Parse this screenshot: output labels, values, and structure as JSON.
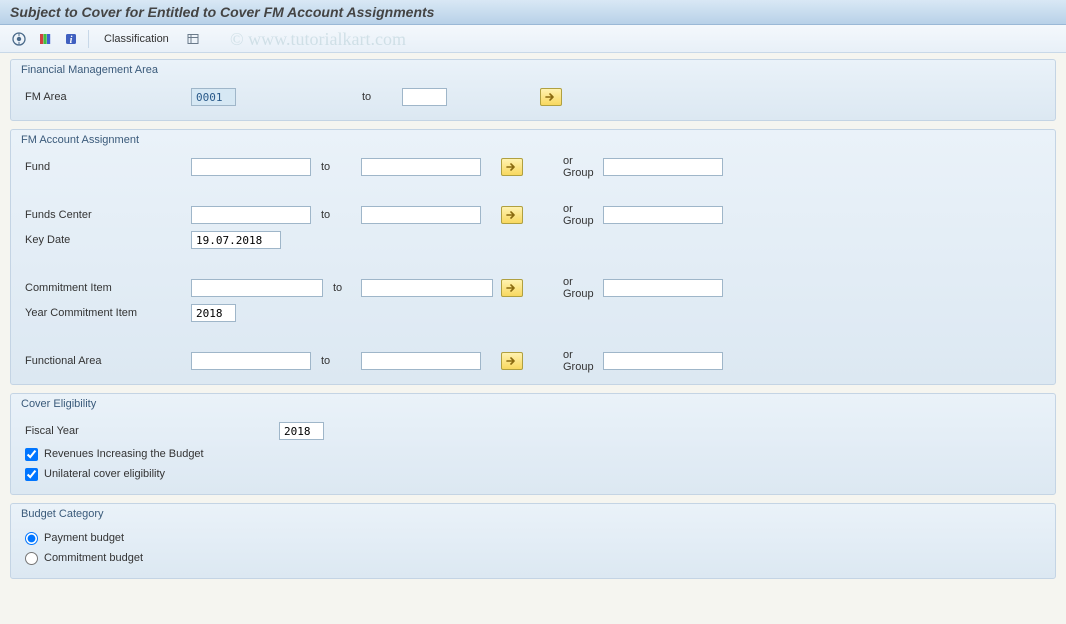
{
  "title": "Subject to Cover for Entitled to Cover FM Account Assignments",
  "watermark": "© www.tutorialkart.com",
  "toolbar": {
    "classification_label": "Classification"
  },
  "groups": {
    "fma": {
      "title": "Financial Management Area",
      "fm_area_label": "FM Area",
      "fm_area_from": "0001",
      "to_label": "to",
      "fm_area_to": ""
    },
    "fmaa": {
      "title": "FM Account Assignment",
      "fund_label": "Fund",
      "fund_from": "",
      "fund_to": "",
      "fund_group": "",
      "to_label": "to",
      "or_group_label": "or Group",
      "funds_center_label": "Funds Center",
      "fc_from": "",
      "fc_to": "",
      "fc_group": "",
      "key_date_label": "Key Date",
      "key_date": "19.07.2018",
      "commitment_item_label": "Commitment Item",
      "ci_from": "",
      "ci_to": "",
      "ci_group": "",
      "year_ci_label": "Year Commitment Item",
      "year_ci": "2018",
      "func_area_label": "Functional Area",
      "fa_from": "",
      "fa_to": "",
      "fa_group": ""
    },
    "cover": {
      "title": "Cover Eligibility",
      "fiscal_year_label": "Fiscal Year",
      "fiscal_year": "2018",
      "rev_label": "Revenues Increasing the Budget",
      "rev_checked": true,
      "uni_label": "Unilateral cover eligibility",
      "uni_checked": true
    },
    "budget": {
      "title": "Budget Category",
      "payment_label": "Payment budget",
      "commitment_label": "Commitment budget",
      "selected": "payment"
    }
  }
}
